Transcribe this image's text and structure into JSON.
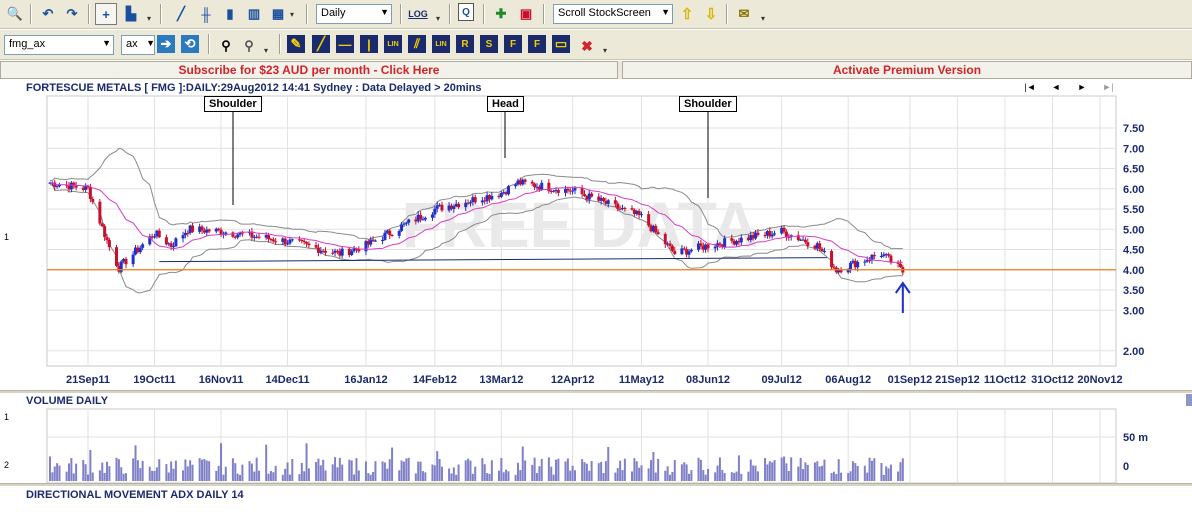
{
  "toolbar": {
    "interval": "Daily",
    "scroll": "Scroll StockScreen",
    "symbol": "fmg_ax",
    "exchange": "ax",
    "log_label": "LOG",
    "icons": [
      "zoom-icon",
      "back-icon",
      "forward-icon",
      "crosshair-icon",
      "new-chart-icon",
      "line-chart-icon",
      "ohlc-chart-icon",
      "candlestick-icon",
      "colored-bars-icon",
      "mixed-chart-icon",
      "log-scale-icon",
      "quote-icon",
      "add-icon",
      "print-icon",
      "arrow-up-icon",
      "arrow-down-icon",
      "email-icon",
      "binoculars-icon",
      "scan-icon",
      "pencil-icon",
      "trendline-icon",
      "hline-icon",
      "vline-icon",
      "lin-icon",
      "parallel-icon",
      "lin2-icon",
      "r-icon",
      "s-icon",
      "fx-icon",
      "fx2-icon",
      "text-icon",
      "delete-icon"
    ],
    "draw_labels": {
      "lin": "LIN",
      "r": "R",
      "s": "S",
      "fx": "F",
      "fx2": "F"
    }
  },
  "banner": {
    "subscribe": "Subscribe for $23 AUD per month - Click Here",
    "activate": "Activate Premium Version"
  },
  "price_panel": {
    "title": "FORTESCUE METALS [ FMG ]:DAILY:29Aug2012 14:41 Sydney : Data Delayed > 20mins",
    "watermark": "FREE DATA",
    "side_number": "1",
    "annotations": [
      {
        "label": "Shoulder"
      },
      {
        "label": "Head"
      },
      {
        "label": "Shoulder"
      }
    ],
    "y_ticks": [
      "7.50",
      "7.00",
      "6.50",
      "6.00",
      "5.50",
      "5.00",
      "4.50",
      "4.00",
      "3.50",
      "3.00",
      "2.00"
    ],
    "x_ticks": [
      "21Sep11",
      "19Oct11",
      "16Nov11",
      "14Dec11",
      "16Jan12",
      "14Feb12",
      "13Mar12",
      "12Apr12",
      "11May12",
      "08Jun12",
      "09Jul12",
      "06Aug12",
      "01Sep12",
      "21Sep12",
      "11Oct12",
      "31Oct12",
      "20Nov12"
    ],
    "nav": [
      "|◄",
      "◄",
      "►",
      "►|"
    ]
  },
  "volume_panel": {
    "title": "VOLUME DAILY",
    "side_numbers": [
      "1",
      "2"
    ],
    "y_ticks": [
      "50 m",
      "0"
    ]
  },
  "adx_panel": {
    "title": "DIRECTIONAL MOVEMENT ADX DAILY 14"
  },
  "colors": {
    "support_line": "#f07d1a",
    "ma_line": "#d93cc6",
    "bollinger": "#8a8a8a",
    "up_candle": "#2030c8",
    "down_candle": "#c8102e",
    "volume": "#8080c8",
    "grid": "#e2e2e2"
  },
  "chart_data": {
    "type": "candlestick",
    "title": "FORTESCUE METALS [ FMG ]:DAILY:29Aug2012 14:41 Sydney : Data Delayed > 20mins",
    "ylim": [
      2.0,
      7.5
    ],
    "support_level": 4.0,
    "neckline": {
      "from": 4.2,
      "to": 4.3
    },
    "close_anchors": [
      {
        "date": "2011-09-05",
        "value": 6.15
      },
      {
        "date": "2011-09-21",
        "value": 6.0
      },
      {
        "date": "2011-10-01",
        "value": 4.4
      },
      {
        "date": "2011-10-04",
        "value": 4.05
      },
      {
        "date": "2011-10-19",
        "value": 4.9
      },
      {
        "date": "2011-10-26",
        "value": 4.6
      },
      {
        "date": "2011-11-02",
        "value": 5.0
      },
      {
        "date": "2011-11-16",
        "value": 4.95
      },
      {
        "date": "2011-12-14",
        "value": 4.7
      },
      {
        "date": "2012-01-05",
        "value": 4.4
      },
      {
        "date": "2012-01-16",
        "value": 4.6
      },
      {
        "date": "2012-02-14",
        "value": 5.5
      },
      {
        "date": "2012-03-13",
        "value": 5.9
      },
      {
        "date": "2012-03-20",
        "value": 6.15
      },
      {
        "date": "2012-04-12",
        "value": 5.95
      },
      {
        "date": "2012-05-11",
        "value": 5.3
      },
      {
        "date": "2012-05-25",
        "value": 4.4
      },
      {
        "date": "2012-06-08",
        "value": 4.6
      },
      {
        "date": "2012-07-09",
        "value": 4.95
      },
      {
        "date": "2012-07-24",
        "value": 4.6
      },
      {
        "date": "2012-08-01",
        "value": 4.0
      },
      {
        "date": "2012-08-06",
        "value": 4.1
      },
      {
        "date": "2012-08-20",
        "value": 4.4
      },
      {
        "date": "2012-08-29",
        "value": 3.95
      }
    ]
  }
}
